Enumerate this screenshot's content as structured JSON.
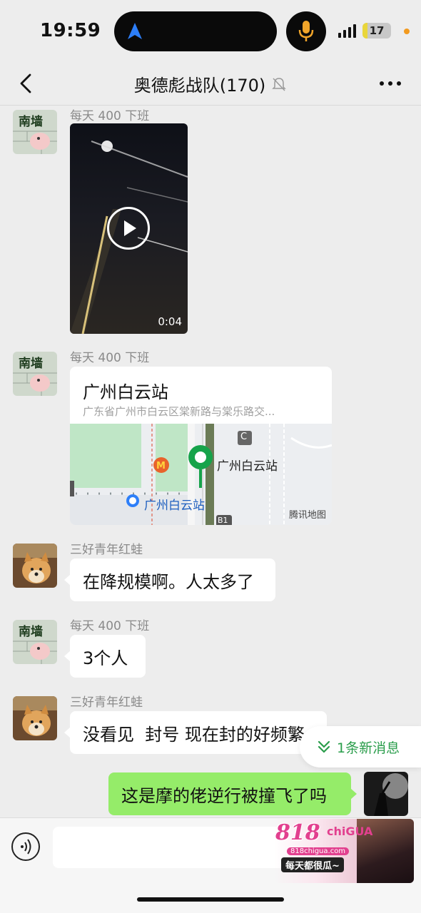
{
  "status_bar": {
    "time": "19:59",
    "battery": "17",
    "battery_level": 0.17
  },
  "header": {
    "title": "奥德彪战队(170)",
    "back_icon": "chevron-left-icon",
    "mute_icon": "bell-slash-icon",
    "more_icon": "ellipsis-icon"
  },
  "messages": [
    {
      "sender": "每天 400 下班",
      "type": "video",
      "duration": "0:04"
    },
    {
      "sender": "每天 400 下班",
      "type": "location",
      "location_name": "广州白云站",
      "address": "广东省广州市白云区棠新路与棠乐路交...",
      "map_poi_1": "广州白云站",
      "map_poi_2": "广州白云站",
      "map_poi_c": "C",
      "map_poi_b": "B1",
      "map_provider": "腾讯地图"
    },
    {
      "sender": "三好青年红蛙",
      "type": "text",
      "text": "在降规模啊。人太多了"
    },
    {
      "sender": "每天 400 下班",
      "type": "text",
      "text": "3个人"
    },
    {
      "sender": "三好青年红蛙",
      "type": "text",
      "text": "没看见  封号 现在封的好频繁"
    },
    {
      "sender": "me",
      "type": "text",
      "text": "这是摩的佬逆行被撞飞了吗"
    }
  ],
  "new_messages": "1条新消息",
  "avatar_text": "南墙",
  "ad": {
    "logo": "818",
    "logo_sub": "chiGUA",
    "url": "818chigua.com",
    "slogan": "每天都很瓜~"
  },
  "colors": {
    "my_bubble": "#95ec69",
    "accent_green": "#2a9d4b",
    "background": "#ededed"
  }
}
